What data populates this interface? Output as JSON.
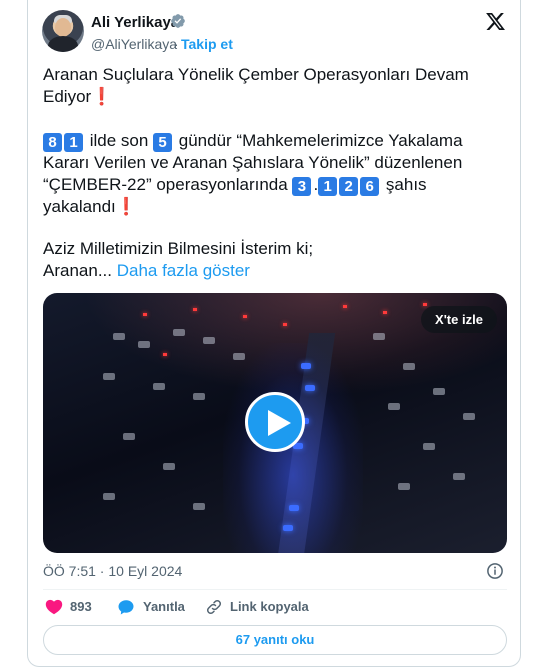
{
  "user": {
    "name": "Ali Yerlikaya",
    "handle": "@AliYerlikaya",
    "separator": "·",
    "follow_label": "Takip et"
  },
  "tweet": {
    "line1": "Aranan Suçlulara Yönelik Çember Operasyonları Devam",
    "line2": "Ediyor",
    "excl": "❗",
    "p2_num1a": "8",
    "p2_num1b": "1",
    "p2_a": " ilde son ",
    "p2_num2": "5",
    "p2_b": " gündür “Mahkemelerimizce Yakalama",
    "p2_line2": "Kararı Verilen ve Aranan Şahıslara Yönelik” düzenlenen",
    "p2_line3": "“ÇEMBER-22” operasyonlarında ",
    "p2_n3": "3",
    "p2_dot": ".",
    "p2_n4": "1",
    "p2_n5": "2",
    "p2_n6": "6",
    "p2_c": " şahıs",
    "p2_line4": "yakalandı",
    "p3_line1": "Aziz Milletimizin Bilmesini İsterim ki;",
    "p3_line2": "Aranan... ",
    "show_more": "Daha fazla göster"
  },
  "video": {
    "watch_label": "X'te izle"
  },
  "meta": {
    "timestamp": "ÖÖ 7:51 · 10 Eyl 2024"
  },
  "actions": {
    "likes": "893",
    "reply_label": "Yanıtla",
    "copy_link_label": "Link kopyala"
  },
  "replies_button": "67 yanıtı oku",
  "colors": {
    "accent": "#1d9bf0",
    "like": "#f91880",
    "keycap": "#2a7be4",
    "exclamation": "#d81f26"
  }
}
